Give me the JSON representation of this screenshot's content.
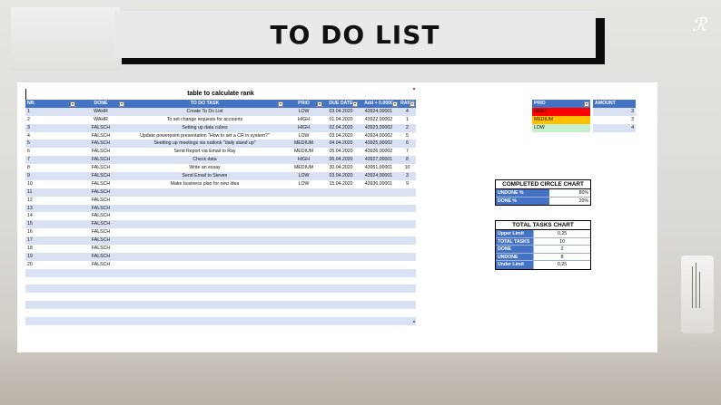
{
  "title": "TO DO LIST",
  "rank_caption": "table to calculate rank",
  "table": {
    "headers": [
      "NR.",
      "DONE",
      "TO DO TASK",
      "PRIO",
      "DUE DATE",
      "Add + 0.0000",
      "RANK"
    ],
    "rows": [
      [
        "1",
        "WAHR",
        "Create To Do List",
        "LOW",
        "03.04.2020",
        "43924,00001",
        "4"
      ],
      [
        "2",
        "WAHR",
        "To set change requests for accounts",
        "HIGH",
        "01.04.2020",
        "43922,00002",
        "1"
      ],
      [
        "3",
        "FALSCH",
        "Setting up data cubes",
        "HIGH",
        "02.04.2020",
        "43923,00002",
        "2"
      ],
      [
        "4",
        "FALSCH",
        "Update powerpoint presentation \"How to set a CR in system?\"",
        "LOW",
        "03.04.2020",
        "43924,00002",
        "5"
      ],
      [
        "5",
        "FALSCH",
        "Seetting up meetings via outlook \"daily stand up\"",
        "MEDIUM",
        "04.04.2020",
        "43925,00002",
        "6"
      ],
      [
        "6",
        "FALSCH",
        "Send Report via Email to Ray",
        "MEDIUM",
        "05.04.2020",
        "43926,00002",
        "7"
      ],
      [
        "7",
        "FALSCH",
        "Check data",
        "HIGH",
        "06.04.2020",
        "43927,00001",
        "8"
      ],
      [
        "8",
        "FALSCH",
        "Write an essay",
        "MEDIUM",
        "30.04.2020",
        "43951,00001",
        "10"
      ],
      [
        "9",
        "FALSCH",
        "Send Email to Steven",
        "LOW",
        "03.04.2020",
        "43924,00001",
        "3"
      ],
      [
        "10",
        "FALSCH",
        "Make business plan for new idea",
        "LOW",
        "15.04.2020",
        "43936,00001",
        "9"
      ],
      [
        "11",
        "FALSCH",
        "",
        "",
        "",
        "",
        ""
      ],
      [
        "12",
        "FALSCH",
        "",
        "",
        "",
        "",
        ""
      ],
      [
        "13",
        "FALSCH",
        "",
        "",
        "",
        "",
        ""
      ],
      [
        "14",
        "FALSCH",
        "",
        "",
        "",
        "",
        ""
      ],
      [
        "15",
        "FALSCH",
        "",
        "",
        "",
        "",
        ""
      ],
      [
        "16",
        "FALSCH",
        "",
        "",
        "",
        "",
        ""
      ],
      [
        "17",
        "FALSCH",
        "",
        "",
        "",
        "",
        ""
      ],
      [
        "18",
        "FALSCH",
        "",
        "",
        "",
        "",
        ""
      ],
      [
        "19",
        "FALSCH",
        "",
        "",
        "",
        "",
        ""
      ],
      [
        "20",
        "FALSCH",
        "",
        "",
        "",
        "",
        ""
      ],
      [
        "",
        "",
        "",
        "",
        "",
        "",
        ""
      ],
      [
        "",
        "",
        "",
        "",
        "",
        "",
        ""
      ],
      [
        "",
        "",
        "",
        "",
        "",
        "",
        ""
      ],
      [
        "",
        "",
        "",
        "",
        "",
        "",
        ""
      ],
      [
        "",
        "",
        "",
        "",
        "",
        "",
        ""
      ],
      [
        "",
        "",
        "",
        "",
        "",
        "",
        ""
      ],
      [
        "",
        "",
        "",
        "",
        "",
        "",
        ""
      ]
    ]
  },
  "prio_table": {
    "headers": [
      "PRIO",
      "AMOUNT"
    ],
    "rows": [
      {
        "label": "HIGH",
        "amount": "3",
        "color": "#ff0000"
      },
      {
        "label": "MEDIUM",
        "amount": "3",
        "color": "#ffc000"
      },
      {
        "label": "LOW",
        "amount": "4",
        "color": "#c6efce"
      }
    ]
  },
  "circle_chart": {
    "title": "COMPLETED CIRCLE CHART",
    "rows": [
      {
        "label": "UNDONE %",
        "value": "80%"
      },
      {
        "label": "DONE %",
        "value": "20%"
      }
    ]
  },
  "tasks_chart": {
    "title": "TOTAL TASKS CHART",
    "rows": [
      {
        "label": "Upper Limit",
        "value": "0,25"
      },
      {
        "label": "TOTAL TASKS",
        "value": "10"
      },
      {
        "label": "DONE",
        "value": "2"
      },
      {
        "label": "UNDONE",
        "value": "8"
      },
      {
        "label": "Under Limit",
        "value": "0,25"
      }
    ]
  },
  "colors": {
    "header_blue": "#4472c4",
    "band_blue": "#d9e1f2",
    "title_shadow": "#0b0b0b"
  }
}
